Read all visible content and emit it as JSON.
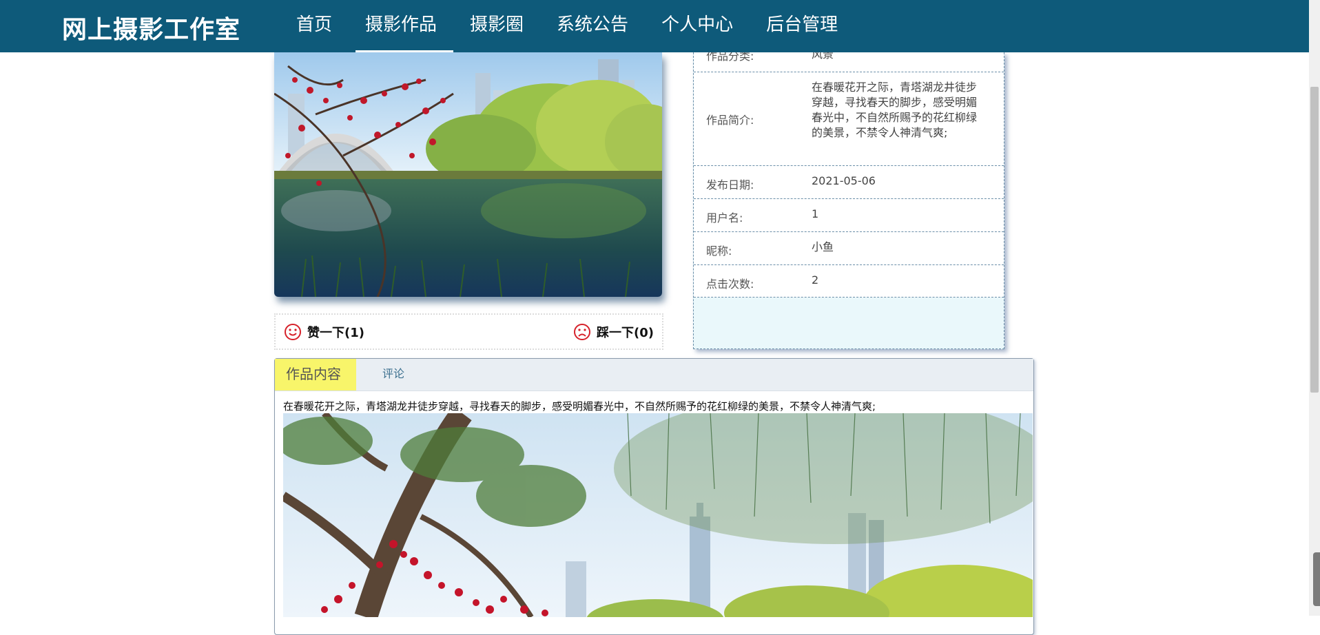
{
  "nav": {
    "brand": "网上摄影工作室",
    "items": [
      {
        "label": "首页"
      },
      {
        "label": "摄影作品"
      },
      {
        "label": "摄影圈"
      },
      {
        "label": "系统公告"
      },
      {
        "label": "个人中心"
      },
      {
        "label": "后台管理"
      }
    ],
    "active_index": 1
  },
  "work": {
    "image_icon": "scenic-photo",
    "votes": {
      "like_label": "赞一下(1)",
      "dislike_label": "踩一下(0)",
      "like_icon": "smile-icon",
      "dislike_icon": "frown-icon"
    },
    "details": [
      {
        "label": "作品分类:",
        "value": "风景"
      },
      {
        "label": "作品简介:",
        "value": "在春暖花开之际，青塔湖龙井徒步穿越，寻找春天的脚步，感受明媚春光中，不自然所赐予的花红柳绿的美景，不禁令人神清气爽;"
      },
      {
        "label": "发布日期:",
        "value": "2021-05-06"
      },
      {
        "label": "用户名:",
        "value": "1"
      },
      {
        "label": "昵称:",
        "value": "小鱼"
      },
      {
        "label": "点击次数:",
        "value": "2"
      }
    ]
  },
  "tabs": [
    {
      "label": "作品内容"
    },
    {
      "label": "评论"
    }
  ],
  "content": {
    "text": "在春暖花开之际，青塔湖龙井徒步穿越，寻找春天的脚步，感受明媚春光中，不自然所赐予的花红柳绿的美景，不禁令人神清气爽;"
  },
  "colors": {
    "nav_bg": "#0e5a7a",
    "active_tab": "#f8f56a",
    "panel_bg": "#eaf8fb",
    "vote_icon": "#d6212a"
  }
}
